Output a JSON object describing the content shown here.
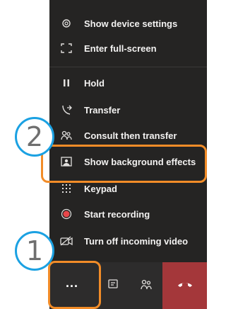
{
  "menu": {
    "items": [
      {
        "label": "Show device settings",
        "icon": "gear-icon"
      },
      {
        "label": "Enter full-screen",
        "icon": "fullscreen-icon"
      },
      {
        "label": "Hold",
        "icon": "pause-icon"
      },
      {
        "label": "Transfer",
        "icon": "transfer-icon"
      },
      {
        "label": "Consult then transfer",
        "icon": "consult-transfer-icon"
      },
      {
        "label": "Show background effects",
        "icon": "background-effects-icon"
      },
      {
        "label": "Keypad",
        "icon": "keypad-icon"
      },
      {
        "label": "Start recording",
        "icon": "record-icon"
      },
      {
        "label": "Turn off incoming video",
        "icon": "video-off-icon"
      }
    ]
  },
  "bottom_bar": {
    "buttons": [
      {
        "label": "...",
        "icon": "more-actions-icon"
      },
      {
        "icon": "chat-icon"
      },
      {
        "icon": "participants-icon"
      },
      {
        "icon": "hang-up-icon"
      }
    ]
  },
  "callouts": [
    {
      "number": "1",
      "target": "more-actions-button"
    },
    {
      "number": "2",
      "target": "show-background-effects"
    }
  ],
  "colors": {
    "menu_bg": "#252423",
    "hangup": "#a4373a",
    "callout_rect": "#f28c28",
    "callout_circle": "#1ba1e2"
  }
}
